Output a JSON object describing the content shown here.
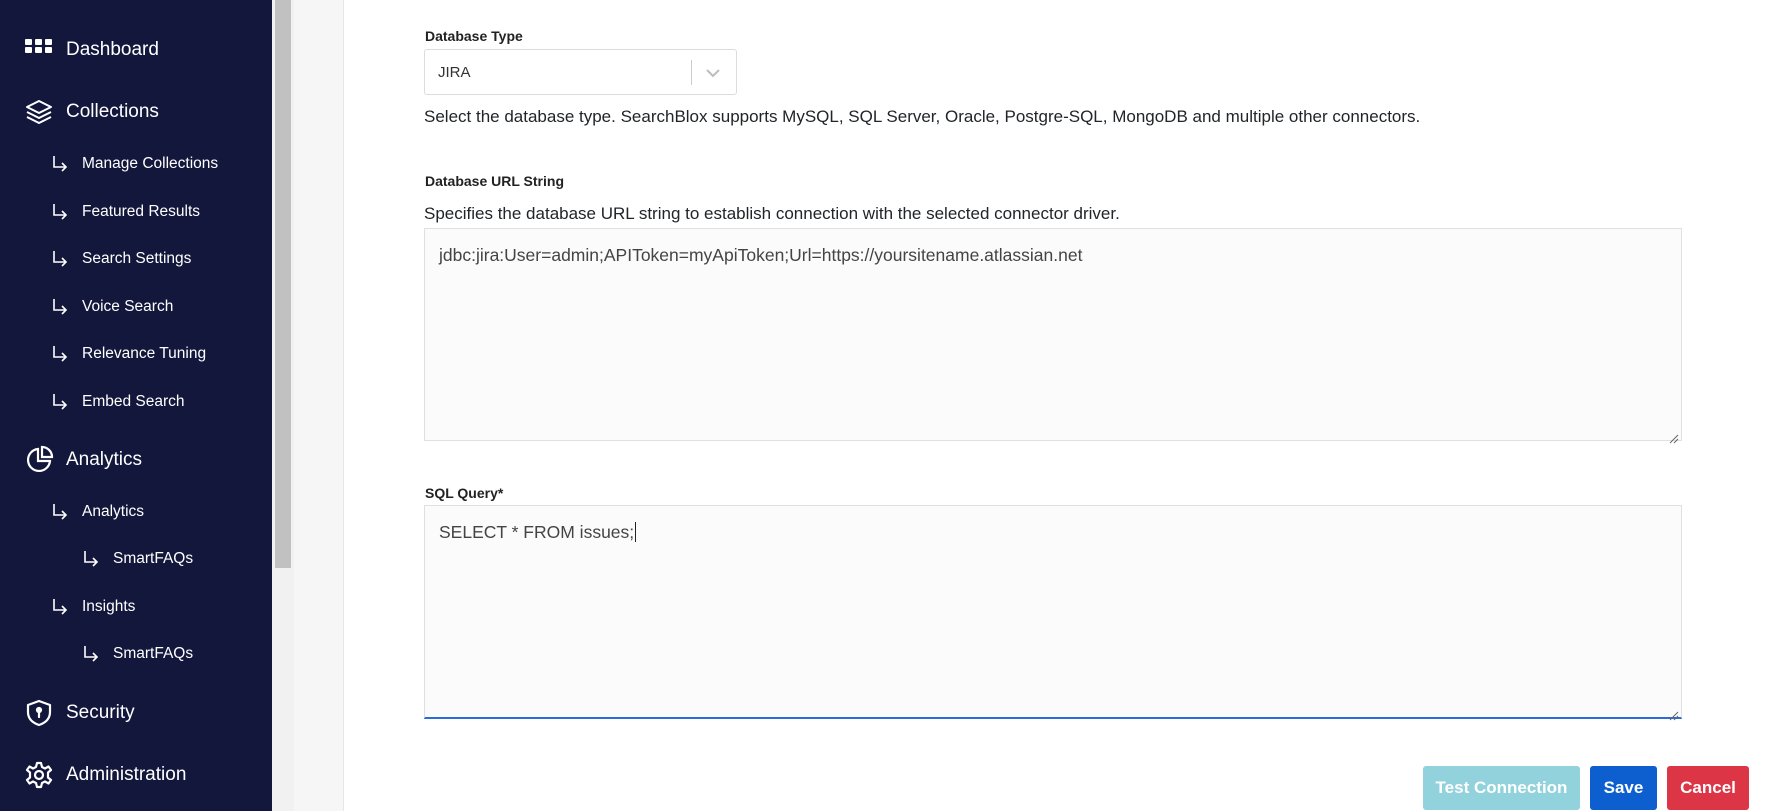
{
  "sidebar": {
    "items": [
      {
        "label": "Dashboard",
        "icon": "dashboard-grid-icon"
      },
      {
        "label": "Collections",
        "icon": "layers-icon"
      },
      {
        "label": "Manage Collections"
      },
      {
        "label": "Featured Results"
      },
      {
        "label": "Search Settings"
      },
      {
        "label": "Voice Search"
      },
      {
        "label": "Relevance Tuning"
      },
      {
        "label": "Embed Search"
      },
      {
        "label": "Analytics",
        "icon": "pie-chart-icon"
      },
      {
        "label": "Analytics"
      },
      {
        "label": "SmartFAQs"
      },
      {
        "label": "Insights"
      },
      {
        "label": "SmartFAQs"
      },
      {
        "label": "Security",
        "icon": "shield-icon"
      },
      {
        "label": "Administration",
        "icon": "gear-icon"
      }
    ]
  },
  "form": {
    "database_type": {
      "label": "Database Type",
      "value": "JIRA",
      "help": "Select the database type. SearchBlox supports MySQL, SQL Server, Oracle, Postgre-SQL, MongoDB and multiple other connectors."
    },
    "database_url": {
      "label": "Database URL String",
      "help": "Specifies the database URL string to establish connection with the selected connector driver.",
      "value": "jdbc:jira:User=admin;APIToken=myApiToken;Url=https://yoursitename.atlassian.net"
    },
    "sql_query": {
      "label": "SQL Query*",
      "value": "SELECT * FROM issues;"
    }
  },
  "buttons": {
    "test_connection": "Test Connection",
    "save": "Save",
    "cancel": "Cancel"
  },
  "colors": {
    "sidebar_bg": "#12173b",
    "test_connection_bg": "#92d2dc",
    "save_bg": "#0d5fd0",
    "cancel_bg": "#dc3545",
    "focus_border": "#2b6cd8"
  }
}
